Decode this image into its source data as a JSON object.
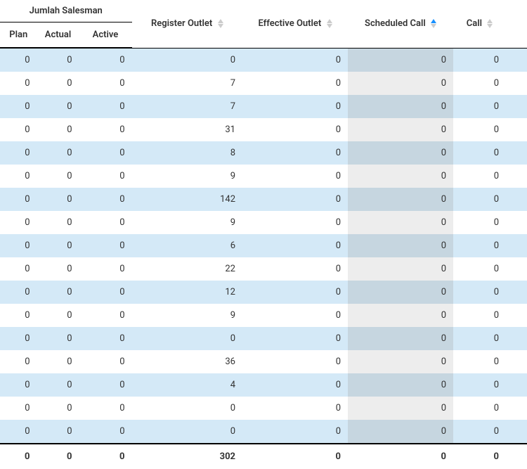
{
  "headers": {
    "group": "Jumlah Salesman",
    "plan": "Plan",
    "actual": "Actual",
    "active": "Active",
    "register_outlet": "Register Outlet",
    "effective_outlet": "Effective Outlet",
    "scheduled_call": "Scheduled Call",
    "call": "Call"
  },
  "rows": [
    {
      "plan": 0,
      "actual": 0,
      "active": 0,
      "register": 0,
      "effective": 0,
      "scheduled": 0,
      "call": 0
    },
    {
      "plan": 0,
      "actual": 0,
      "active": 0,
      "register": 7,
      "effective": 0,
      "scheduled": 0,
      "call": 0
    },
    {
      "plan": 0,
      "actual": 0,
      "active": 0,
      "register": 7,
      "effective": 0,
      "scheduled": 0,
      "call": 0
    },
    {
      "plan": 0,
      "actual": 0,
      "active": 0,
      "register": 31,
      "effective": 0,
      "scheduled": 0,
      "call": 0
    },
    {
      "plan": 0,
      "actual": 0,
      "active": 0,
      "register": 8,
      "effective": 0,
      "scheduled": 0,
      "call": 0
    },
    {
      "plan": 0,
      "actual": 0,
      "active": 0,
      "register": 9,
      "effective": 0,
      "scheduled": 0,
      "call": 0
    },
    {
      "plan": 0,
      "actual": 0,
      "active": 0,
      "register": 142,
      "effective": 0,
      "scheduled": 0,
      "call": 0
    },
    {
      "plan": 0,
      "actual": 0,
      "active": 0,
      "register": 9,
      "effective": 0,
      "scheduled": 0,
      "call": 0
    },
    {
      "plan": 0,
      "actual": 0,
      "active": 0,
      "register": 6,
      "effective": 0,
      "scheduled": 0,
      "call": 0
    },
    {
      "plan": 0,
      "actual": 0,
      "active": 0,
      "register": 22,
      "effective": 0,
      "scheduled": 0,
      "call": 0
    },
    {
      "plan": 0,
      "actual": 0,
      "active": 0,
      "register": 12,
      "effective": 0,
      "scheduled": 0,
      "call": 0
    },
    {
      "plan": 0,
      "actual": 0,
      "active": 0,
      "register": 9,
      "effective": 0,
      "scheduled": 0,
      "call": 0
    },
    {
      "plan": 0,
      "actual": 0,
      "active": 0,
      "register": 0,
      "effective": 0,
      "scheduled": 0,
      "call": 0
    },
    {
      "plan": 0,
      "actual": 0,
      "active": 0,
      "register": 36,
      "effective": 0,
      "scheduled": 0,
      "call": 0
    },
    {
      "plan": 0,
      "actual": 0,
      "active": 0,
      "register": 4,
      "effective": 0,
      "scheduled": 0,
      "call": 0
    },
    {
      "plan": 0,
      "actual": 0,
      "active": 0,
      "register": 0,
      "effective": 0,
      "scheduled": 0,
      "call": 0
    },
    {
      "plan": 0,
      "actual": 0,
      "active": 0,
      "register": 0,
      "effective": 0,
      "scheduled": 0,
      "call": 0
    }
  ],
  "totals": {
    "plan": 0,
    "actual": 0,
    "active": 0,
    "register": 302,
    "effective": 0,
    "scheduled": 0,
    "call": 0
  }
}
